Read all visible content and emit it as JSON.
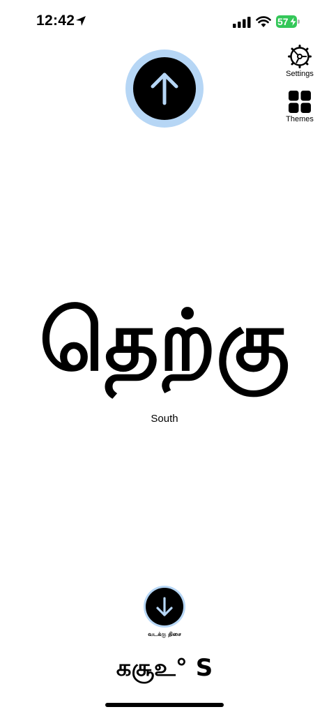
{
  "status_bar": {
    "time": "12:42",
    "battery_level": "57",
    "battery_color": "#34c759"
  },
  "compass": {
    "arrow_direction": "up",
    "ring_color": "#b6d6f5",
    "direction_tamil": "தெற்கு",
    "direction_english": "South"
  },
  "side_buttons": {
    "settings_label": "Settings",
    "themes_label": "Themes"
  },
  "north_indicator": {
    "arrow_direction": "down",
    "label": "வடக்கு திசை"
  },
  "heading": {
    "readout": "கசூஉ° S"
  }
}
